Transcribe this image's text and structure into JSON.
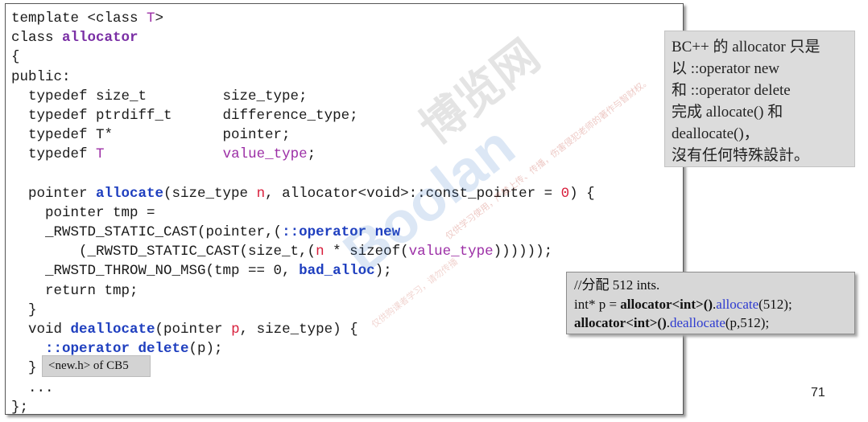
{
  "code_lines": [
    [
      {
        "t": "template <class "
      },
      {
        "t": "T",
        "c": "pu"
      },
      {
        "t": ">"
      }
    ],
    [
      {
        "t": "class "
      },
      {
        "t": "allocator",
        "c": "kwb"
      }
    ],
    [
      {
        "t": "{"
      }
    ],
    [
      {
        "t": "public:"
      }
    ],
    [
      {
        "t": "  typedef size_t         size_type;"
      }
    ],
    [
      {
        "t": "  typedef ptrdiff_t      difference_type;"
      }
    ],
    [
      {
        "t": "  typedef T*             pointer;"
      }
    ],
    [
      {
        "t": "  typedef "
      },
      {
        "t": "T",
        "c": "pu"
      },
      {
        "t": "              "
      },
      {
        "t": "value_type",
        "c": "pu"
      },
      {
        "t": ";"
      }
    ],
    [
      {
        "t": ""
      }
    ],
    [
      {
        "t": "  pointer "
      },
      {
        "t": "allocate",
        "c": "kw"
      },
      {
        "t": "(size_type "
      },
      {
        "t": "n",
        "c": "rd"
      },
      {
        "t": ", allocator<void>::const_pointer = "
      },
      {
        "t": "0",
        "c": "rd"
      },
      {
        "t": ") {"
      }
    ],
    [
      {
        "t": "    pointer tmp ="
      }
    ],
    [
      {
        "t": "    _RWSTD_STATIC_CAST(pointer,("
      },
      {
        "t": "::operator new",
        "c": "kw"
      }
    ],
    [
      {
        "t": "        (_RWSTD_STATIC_CAST(size_t,("
      },
      {
        "t": "n",
        "c": "rd"
      },
      {
        "t": " * sizeof("
      },
      {
        "t": "value_type",
        "c": "pu"
      },
      {
        "t": "))))));"
      }
    ],
    [
      {
        "t": "    _RWSTD_THROW_NO_MSG(tmp == 0, "
      },
      {
        "t": "bad_alloc",
        "c": "kw"
      },
      {
        "t": ");"
      }
    ],
    [
      {
        "t": "    return tmp;"
      }
    ],
    [
      {
        "t": "  }"
      }
    ],
    [
      {
        "t": "  void "
      },
      {
        "t": "deallocate",
        "c": "kw"
      },
      {
        "t": "(pointer "
      },
      {
        "t": "p",
        "c": "rd"
      },
      {
        "t": ", size_type) {"
      }
    ],
    [
      {
        "t": "    "
      },
      {
        "t": "::operator delete",
        "c": "kw"
      },
      {
        "t": "(p);"
      }
    ],
    [
      {
        "t": "  }"
      }
    ],
    [
      {
        "t": "  ..."
      }
    ],
    [
      {
        "t": "};"
      }
    ]
  ],
  "note": {
    "lines": [
      "BC++ 的 allocator 只是",
      "以 ::operator new",
      "和 ::operator delete",
      "完成 allocate() 和",
      "deallocate()，",
      "沒有任何特殊設計。"
    ]
  },
  "usage": {
    "comment": "//分配 512 ints.",
    "line1": [
      {
        "t": "int* p = "
      },
      {
        "t": "allocator<int>()",
        "c": "bold"
      },
      {
        "t": "."
      },
      {
        "t": "allocate",
        "c": "blue"
      },
      {
        "t": "(512);"
      }
    ],
    "line2": [
      {
        "t": "allocator<int>()",
        "c": "bold"
      },
      {
        "t": "."
      },
      {
        "t": "deallocate",
        "c": "blue"
      },
      {
        "t": "(p,512);"
      }
    ]
  },
  "source_tag": "<new.h> of CB5",
  "page_number": "71",
  "watermark": {
    "brand": "Boolan",
    "title": "博览网",
    "line1": "仅供学习使用，严禁上传、传播，伤害侵犯老师的著作与智财权。",
    "line2": "仅供购课者学习，请勿传播"
  }
}
